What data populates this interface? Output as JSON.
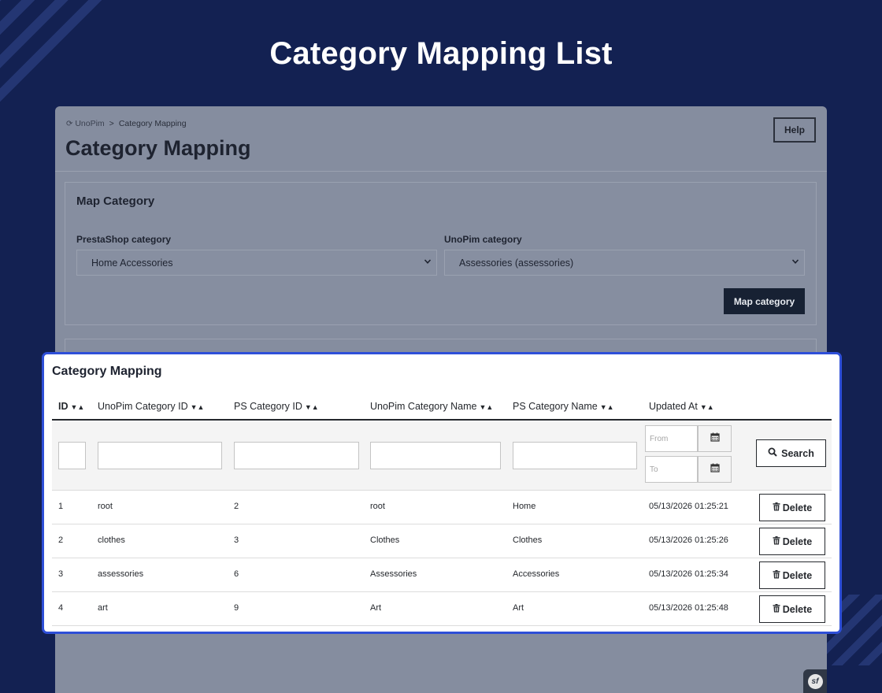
{
  "headline": "Category Mapping List",
  "breadcrumb": {
    "home": "UnoPim",
    "separator": ">",
    "current": "Category Mapping"
  },
  "page_title": "Category Mapping",
  "help_label": "Help",
  "map_panel": {
    "title": "Map Category",
    "presta_label": "PrestaShop category",
    "presta_value": "Home Accessories",
    "unopim_label": "UnoPim category",
    "unopim_value": "Assessories (assessories)",
    "map_button": "Map category"
  },
  "table": {
    "title": "Category Mapping",
    "columns": [
      "ID",
      "UnoPim Category ID",
      "PS Category ID",
      "UnoPim Category Name",
      "PS Category Name",
      "Updated At"
    ],
    "sort_glyph": "▼▲",
    "filters": {
      "from_placeholder": "From",
      "to_placeholder": "To",
      "search_label": "Search"
    },
    "delete_label": "Delete",
    "rows": [
      {
        "id": "1",
        "unopim_id": "root",
        "ps_id": "2",
        "unopim_name": "root",
        "ps_name": "Home",
        "updated": "05/13/2026 01:25:21"
      },
      {
        "id": "2",
        "unopim_id": "clothes",
        "ps_id": "3",
        "unopim_name": "Clothes",
        "ps_name": "Clothes",
        "updated": "05/13/2026 01:25:26"
      },
      {
        "id": "3",
        "unopim_id": "assessories",
        "ps_id": "6",
        "unopim_name": "Assessories",
        "ps_name": "Accessories",
        "updated": "05/13/2026 01:25:34"
      },
      {
        "id": "4",
        "unopim_id": "art",
        "ps_id": "9",
        "unopim_name": "Art",
        "ps_name": "Art",
        "updated": "05/13/2026 01:25:48"
      }
    ]
  },
  "icons": {
    "refresh": "refresh-icon",
    "calendar": "calendar-icon",
    "search": "search-icon",
    "trash": "trash-icon",
    "chevron": "chevron-down-icon",
    "symfony": "symfony-icon"
  },
  "symfony_badge": "sf",
  "colors": {
    "background": "#132152",
    "accent_border": "#2e4fd8",
    "button_dark": "#172133",
    "overlay": "#858d9f"
  }
}
